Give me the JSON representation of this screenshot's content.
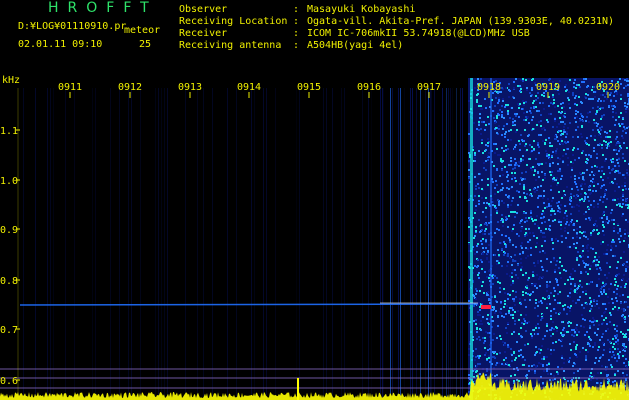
{
  "header": {
    "app_title": "HROFFT",
    "log_path": "D:¥LOG¥01110910.pr",
    "meteor_label": "meteor",
    "datetime": "02.01.11 09:10",
    "count": "25"
  },
  "info": [
    {
      "label": "Observer",
      "value": "Masayuki Kobayashi"
    },
    {
      "label": "Receiving Location",
      "value": "Ogata-vill. Akita-Pref. JAPAN (139.9303E, 40.0231N)"
    },
    {
      "label": "Receiver",
      "value": "ICOM IC-706mkII 53.74918(@LCD)MHz USB"
    },
    {
      "label": "Receiving antenna",
      "value": "A504HB(yagi 4el)"
    }
  ],
  "info_separator": ":",
  "axis": {
    "y_unit": "kHz",
    "y_ticks": [
      "1.1",
      "1.0",
      "0.9",
      "0.8",
      "0.7",
      "0.6"
    ],
    "time_ticks": [
      "0911",
      "0912",
      "0913",
      "0914",
      "0915",
      "0916",
      "0917",
      "0918",
      "0919",
      "0920"
    ]
  },
  "colors": {
    "background": "#000000",
    "title": "#2ee36a",
    "text": "#f0f000",
    "noise_low": "#0a1a8c",
    "noise_mid": "#1f6fff",
    "noise_high": "#18e0e0",
    "signal": "#ffffff",
    "hot_spot": "#ff2040",
    "amplitude_trace": "#ffff00"
  }
}
